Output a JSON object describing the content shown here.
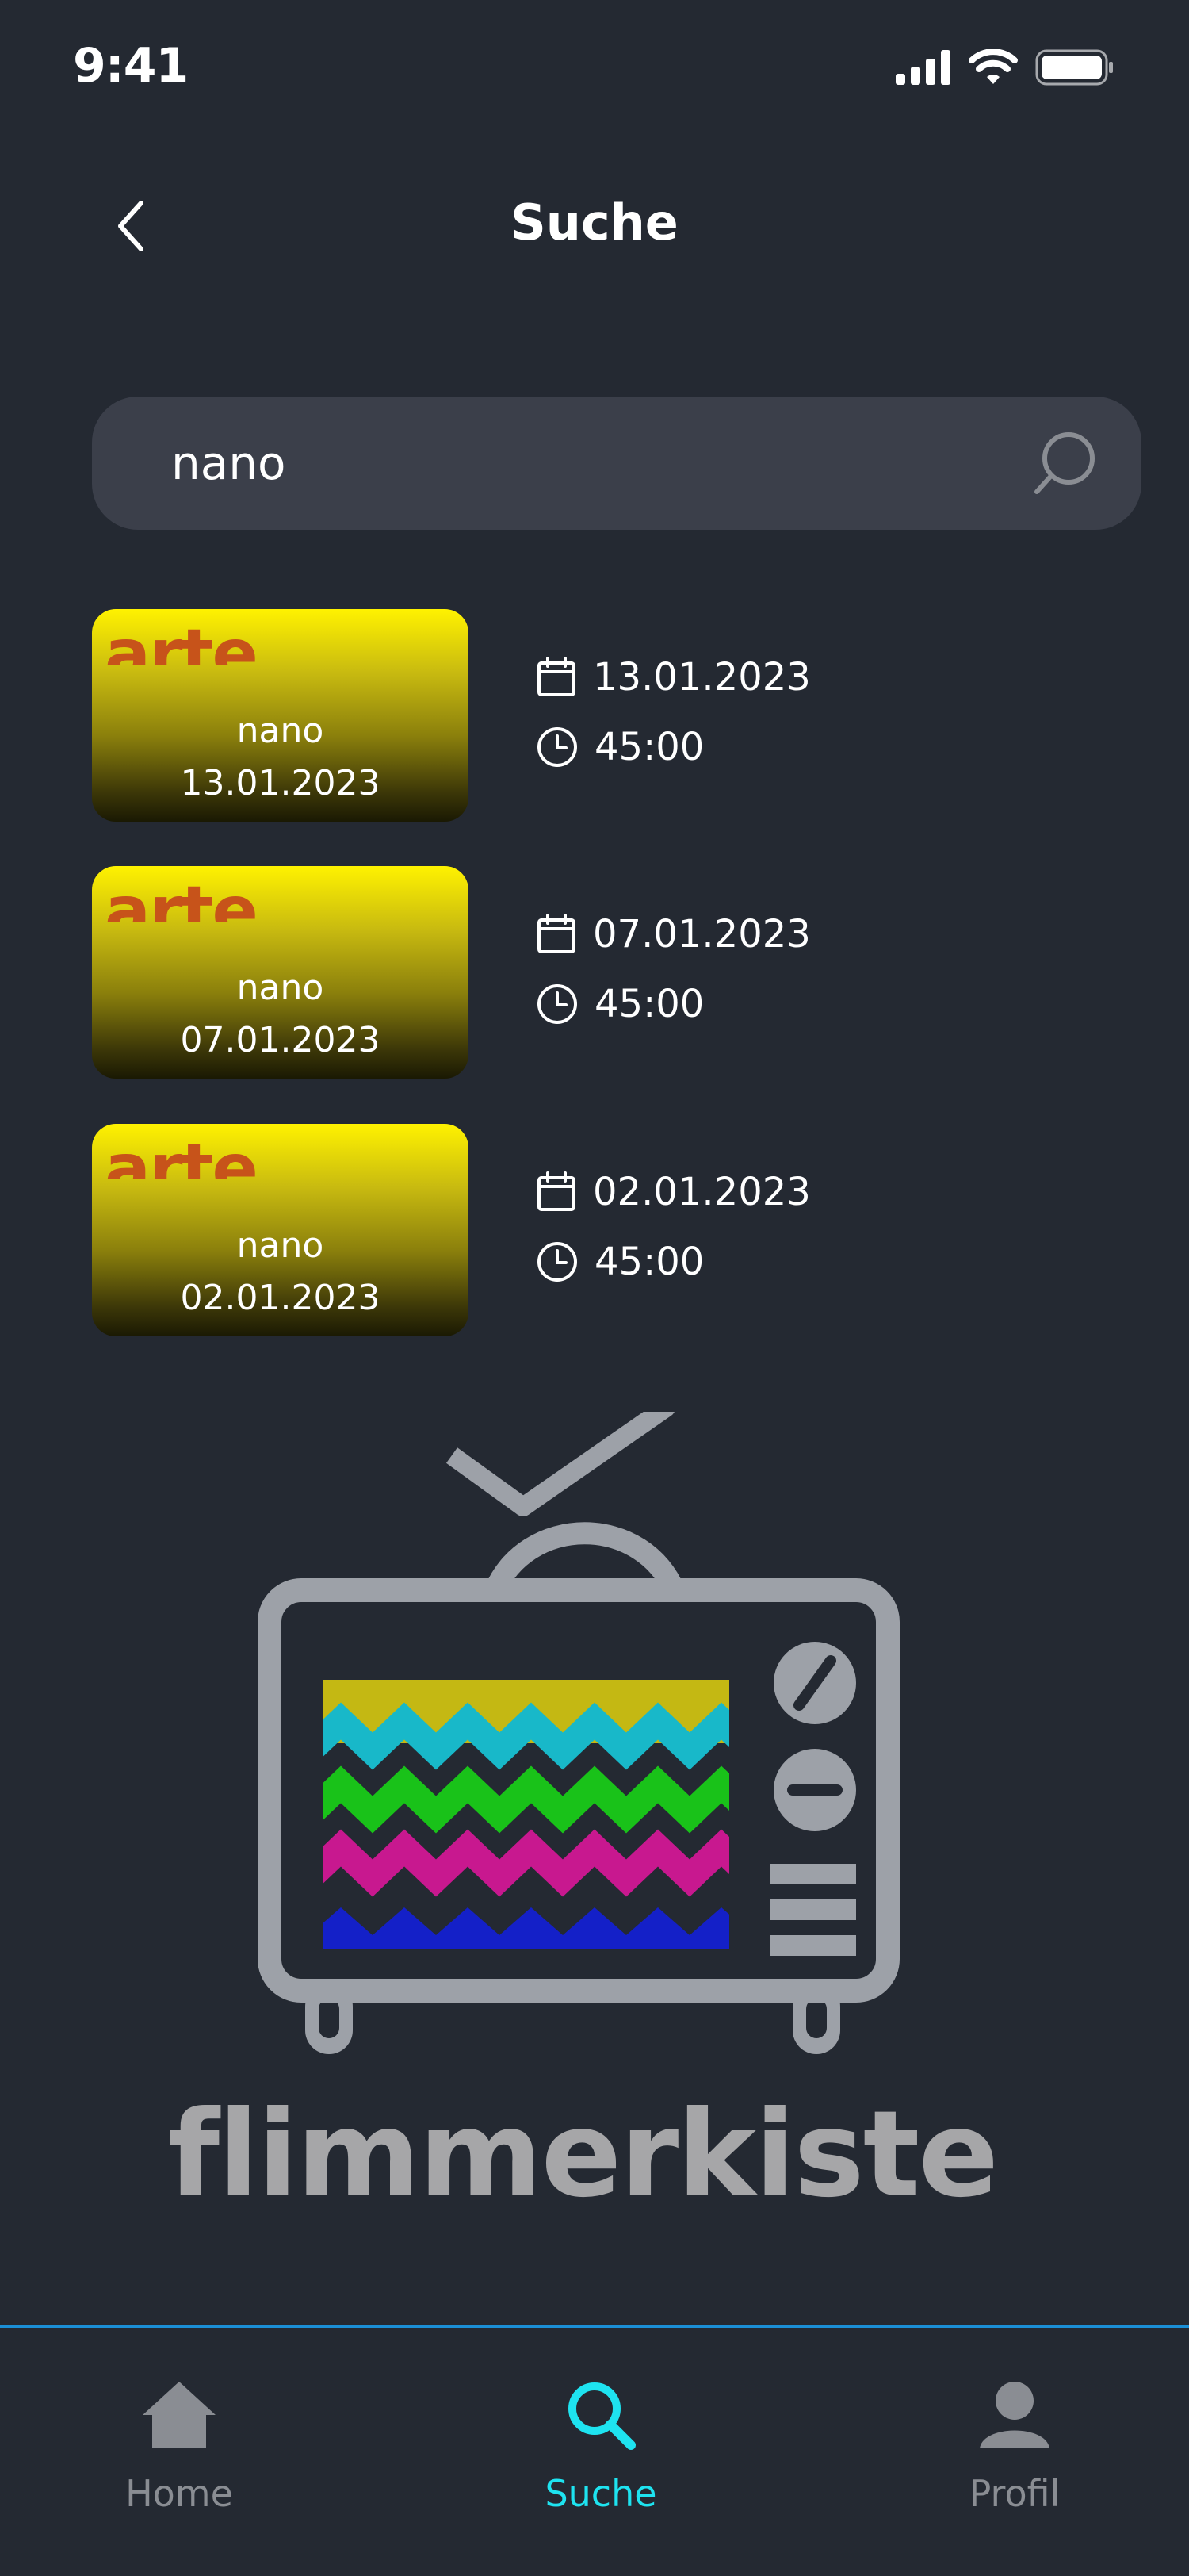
{
  "status_bar": {
    "time": "9:41"
  },
  "header": {
    "title": "Suche"
  },
  "search": {
    "value": "nano"
  },
  "results": [
    {
      "channel_logo": "arte",
      "title": "nano",
      "thumb_date": "13.01.2023",
      "date": "13.01.2023",
      "duration": "45:00"
    },
    {
      "channel_logo": "arte",
      "title": "nano",
      "thumb_date": "07.01.2023",
      "date": "07.01.2023",
      "duration": "45:00"
    },
    {
      "channel_logo": "arte",
      "title": "nano",
      "thumb_date": "02.01.2023",
      "date": "02.01.2023",
      "duration": "45:00"
    }
  ],
  "brand": {
    "name": "flimmerkiste"
  },
  "tab_bar": {
    "items": [
      {
        "label": "Home",
        "icon": "home-icon",
        "active": false
      },
      {
        "label": "Suche",
        "icon": "search-icon",
        "active": true
      },
      {
        "label": "Profil",
        "icon": "user-icon",
        "active": false
      }
    ]
  },
  "colors": {
    "background": "#242932",
    "search_field": "#3b3f4a",
    "accent": "#1ee3f0",
    "tab_inactive": "#8a8d93",
    "divider": "#1b8fd6",
    "logo_gray": "#a6a6a8"
  }
}
